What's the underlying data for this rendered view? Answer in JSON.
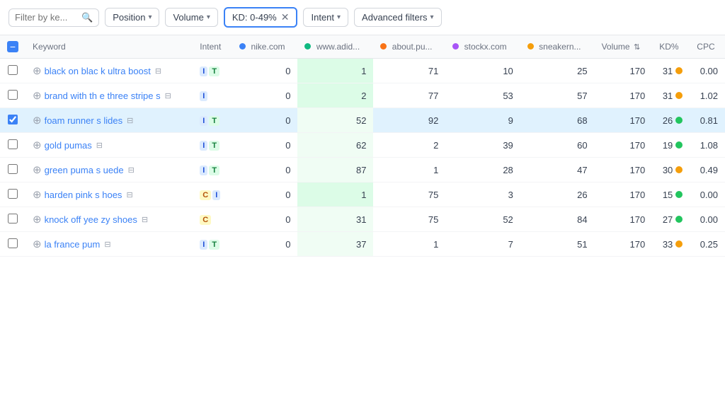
{
  "toolbar": {
    "filter_placeholder": "Filter by ke...",
    "search_icon": "🔍",
    "position_label": "Position",
    "volume_label": "Volume",
    "kd_filter_label": "KD: 0-49%",
    "intent_label": "Intent",
    "advanced_filters_label": "Advanced filters"
  },
  "table": {
    "headers": {
      "keyword": "Keyword",
      "intent": "Intent",
      "nike": "nike.com",
      "adidas": "www.adid...",
      "about": "about.pu...",
      "stockx": "stockx.com",
      "sneakers": "sneakern...",
      "volume": "Volume",
      "kd": "KD%",
      "cpc": "CPC"
    },
    "rows": [
      {
        "keyword": "black on blac k ultra boost",
        "intent": [
          "I",
          "T"
        ],
        "nike": "0",
        "adidas": "1",
        "about": "71",
        "stockx": "10",
        "sneakers": "25",
        "volume": "170",
        "kd": "31",
        "kd_color": "yellow",
        "cpc": "0.00",
        "selected": false
      },
      {
        "keyword": "brand with th e three stripe s",
        "intent": [
          "I"
        ],
        "nike": "0",
        "adidas": "2",
        "about": "77",
        "stockx": "53",
        "sneakers": "57",
        "volume": "170",
        "kd": "31",
        "kd_color": "yellow",
        "cpc": "1.02",
        "selected": false
      },
      {
        "keyword": "foam runner s lides",
        "intent": [
          "I",
          "T"
        ],
        "nike": "0",
        "adidas": "52",
        "about": "92",
        "stockx": "9",
        "sneakers": "68",
        "volume": "170",
        "kd": "26",
        "kd_color": "green",
        "cpc": "0.81",
        "selected": true
      },
      {
        "keyword": "gold pumas",
        "intent": [
          "I",
          "T"
        ],
        "nike": "0",
        "adidas": "62",
        "about": "2",
        "stockx": "39",
        "sneakers": "60",
        "volume": "170",
        "kd": "19",
        "kd_color": "green",
        "cpc": "1.08",
        "selected": false
      },
      {
        "keyword": "green puma s uede",
        "intent": [
          "I",
          "T"
        ],
        "nike": "0",
        "adidas": "87",
        "about": "1",
        "stockx": "28",
        "sneakers": "47",
        "volume": "170",
        "kd": "30",
        "kd_color": "yellow",
        "cpc": "0.49",
        "selected": false
      },
      {
        "keyword": "harden pink s hoes",
        "intent": [
          "C",
          "I"
        ],
        "nike": "0",
        "adidas": "1",
        "about": "75",
        "stockx": "3",
        "sneakers": "26",
        "volume": "170",
        "kd": "15",
        "kd_color": "green",
        "cpc": "0.00",
        "selected": false
      },
      {
        "keyword": "knock off yee zy shoes",
        "intent": [
          "C"
        ],
        "nike": "0",
        "adidas": "31",
        "about": "75",
        "stockx": "52",
        "sneakers": "84",
        "volume": "170",
        "kd": "27",
        "kd_color": "green",
        "cpc": "0.00",
        "selected": false
      },
      {
        "keyword": "la france pum",
        "intent": [
          "I",
          "T"
        ],
        "nike": "0",
        "adidas": "37",
        "about": "1",
        "stockx": "7",
        "sneakers": "51",
        "volume": "170",
        "kd": "33",
        "kd_color": "yellow",
        "cpc": "0.25",
        "selected": false
      }
    ]
  }
}
